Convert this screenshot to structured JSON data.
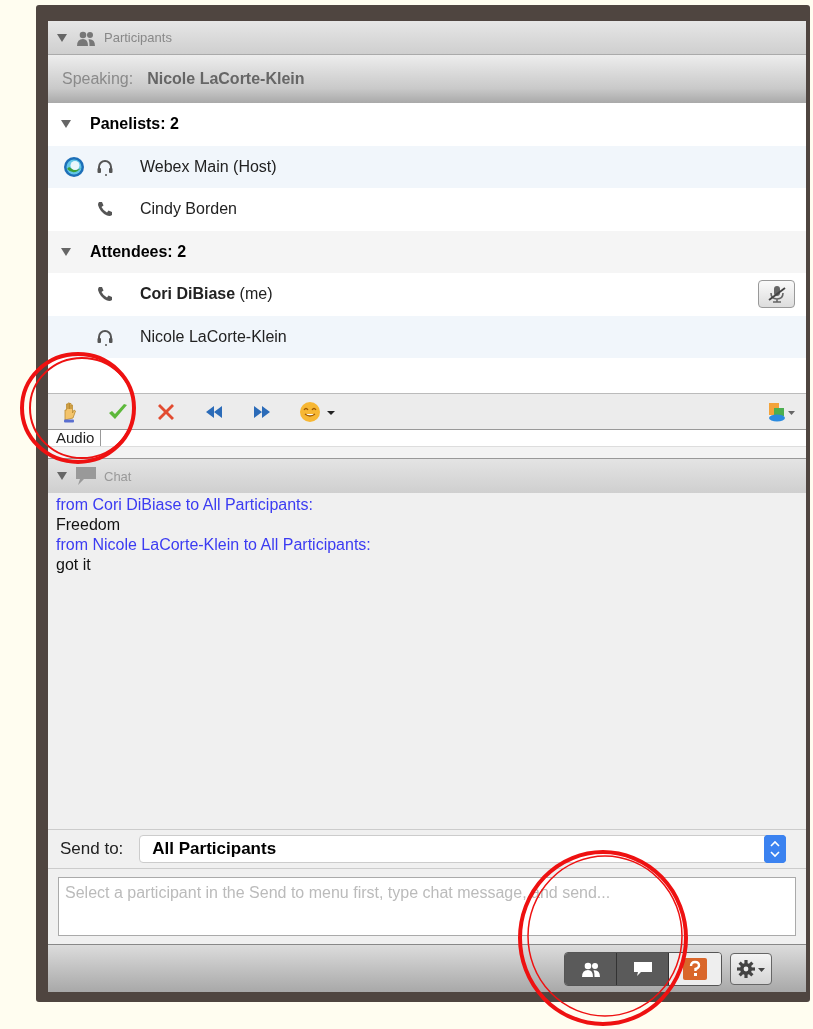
{
  "participants_panel": {
    "title": "Participants",
    "expanded": true,
    "speaking": {
      "label": "Speaking:",
      "name": "Nicole LaCorte-Klein"
    },
    "groups": [
      {
        "label": "Panelists: 2",
        "expanded": true,
        "members": [
          {
            "name": "Webex Main (Host)",
            "kind": "headset",
            "host": true,
            "mute_button": false
          },
          {
            "name": "Cindy Borden",
            "kind": "phone",
            "host": false,
            "mute_button": false
          }
        ]
      },
      {
        "label": "Attendees: 2",
        "expanded": true,
        "members": [
          {
            "name": "**Cori DiBiase** (me)",
            "kind": "phone",
            "host": false,
            "mute_button": true
          },
          {
            "name": "Nicole LaCorte-Klein",
            "kind": "headset",
            "host": false,
            "mute_button": false
          }
        ]
      }
    ],
    "tabs": [
      {
        "label": "Audio",
        "selected": true
      }
    ]
  },
  "chat_panel": {
    "title": "Chat",
    "expanded": true,
    "messages": [
      {
        "kind": "header",
        "text": "from Cori DiBiase to All Participants:"
      },
      {
        "kind": "text",
        "text": "Freedom"
      },
      {
        "kind": "header",
        "text": "from Nicole LaCorte-Klein to All Participants:"
      },
      {
        "kind": "text",
        "text": "got it"
      }
    ],
    "send_to": {
      "label": "Send to:",
      "value": "All Participants"
    },
    "message": {
      "placeholder": "Select a participant in the Send to menu first, type chat message, and send..."
    }
  },
  "footer": {
    "toggles": [
      {
        "kind": "participants",
        "selected": true
      },
      {
        "kind": "chat",
        "selected": true
      }
    ]
  }
}
